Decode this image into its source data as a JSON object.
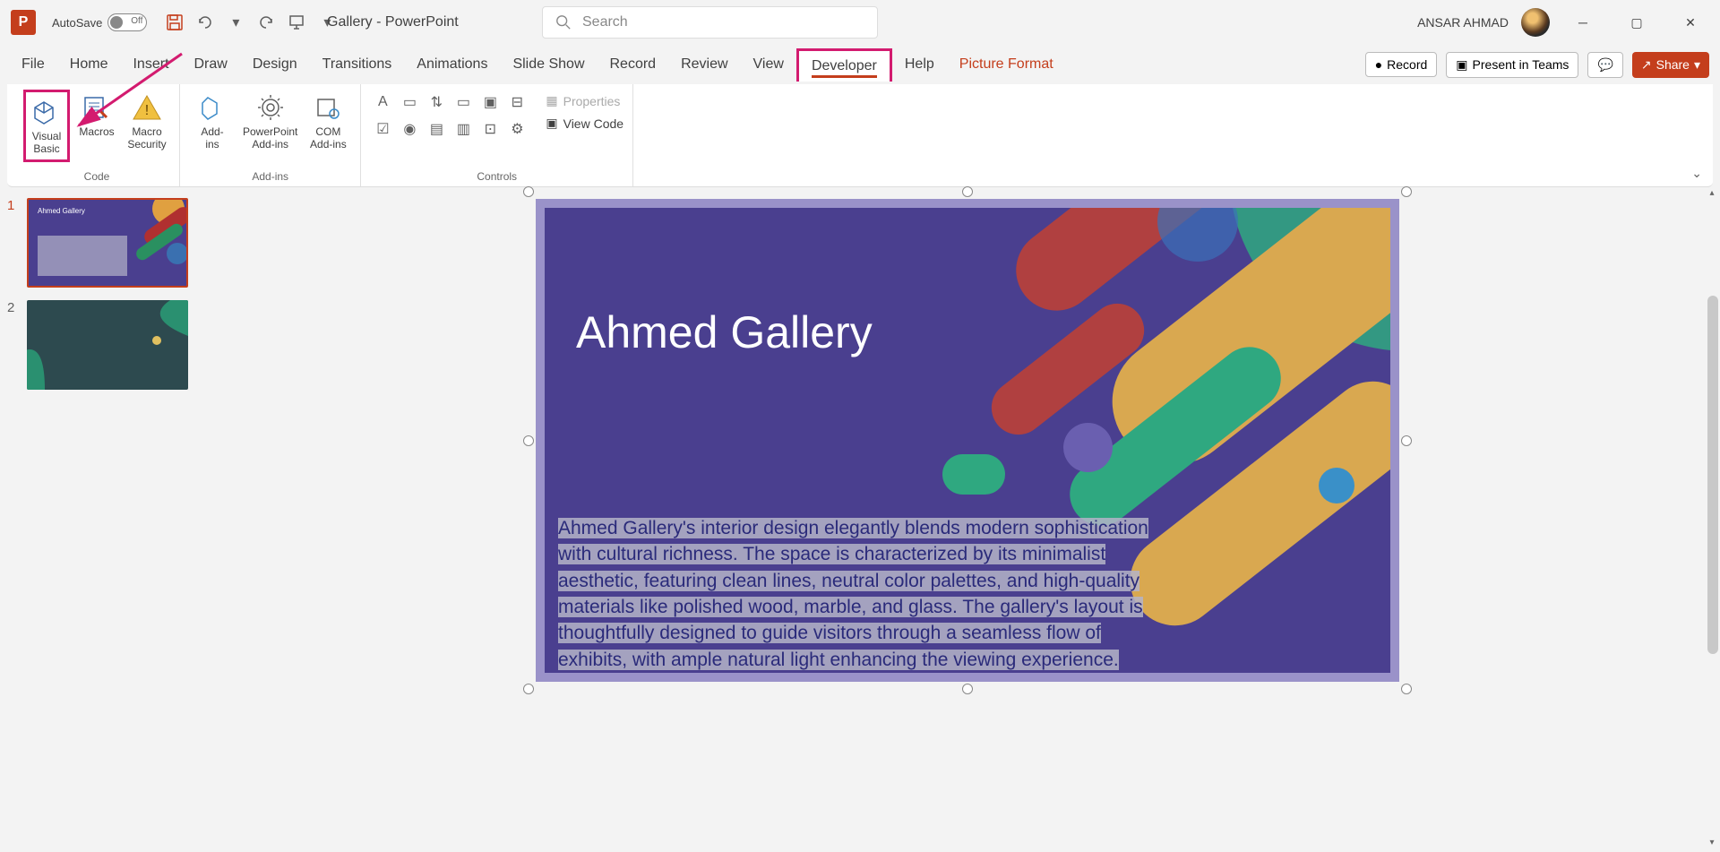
{
  "app": {
    "letter": "P",
    "autosave_label": "AutoSave",
    "autosave_state": "Off",
    "doc_title": "Gallery  -  PowerPoint",
    "search_placeholder": "Search",
    "user": "ANSAR AHMAD"
  },
  "tabs": {
    "items": [
      "File",
      "Home",
      "Insert",
      "Draw",
      "Design",
      "Transitions",
      "Animations",
      "Slide Show",
      "Record",
      "Review",
      "View",
      "Developer",
      "Help",
      "Picture Format"
    ],
    "active": "Developer",
    "record_btn": "Record",
    "present_btn": "Present in Teams",
    "share_btn": "Share"
  },
  "ribbon": {
    "code": {
      "label": "Code",
      "visual_basic": "Visual\nBasic",
      "macros": "Macros",
      "macro_security": "Macro\nSecurity"
    },
    "addins": {
      "label": "Add-ins",
      "addins": "Add-\nins",
      "ppt_addins": "PowerPoint\nAdd-ins",
      "com_addins": "COM\nAdd-ins"
    },
    "controls": {
      "label": "Controls",
      "properties": "Properties",
      "view_code": "View Code"
    }
  },
  "thumbs": {
    "n1": "1",
    "n2": "2",
    "t1_title": "Ahmed Gallery"
  },
  "slide": {
    "title": "Ahmed Gallery",
    "body": "Ahmed Gallery's interior design elegantly blends modern sophistication with cultural richness. The space is characterized by its minimalist aesthetic, featuring clean lines, neutral color palettes, and high-quality materials like polished wood, marble, and glass. The gallery's layout is thoughtfully designed to guide visitors through a seamless flow of exhibits, with ample natural light enhancing the viewing experience."
  }
}
